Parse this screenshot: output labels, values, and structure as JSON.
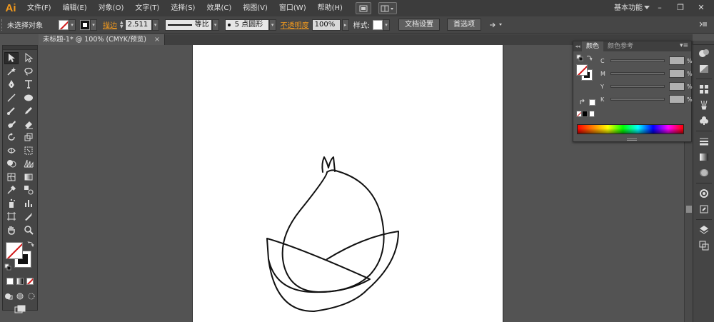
{
  "app": {
    "logo": "Ai"
  },
  "menu": [
    "文件(F)",
    "编辑(E)",
    "对象(O)",
    "文字(T)",
    "选择(S)",
    "效果(C)",
    "视图(V)",
    "窗口(W)",
    "帮助(H)"
  ],
  "workspace": {
    "label": "基本功能"
  },
  "window_controls": {
    "minimize": "–",
    "restore": "❐",
    "close": "✕"
  },
  "control_bar": {
    "selection_label": "未选择对象",
    "stroke_label": "描边",
    "stroke_weight": "2.511",
    "stroke_profile": "等比",
    "brush_label": "5 点圆形",
    "opacity_label": "不透明度",
    "opacity_value": "100%",
    "style_label": "样式:",
    "doc_setup_button": "文档设置",
    "preferences_button": "首选项"
  },
  "document_tab": {
    "title": "未标题-1* @ 100% (CMYK/预览)",
    "close": "×"
  },
  "color_panel": {
    "tabs": [
      "颜色",
      "颜色参考"
    ],
    "channels": [
      "C",
      "M",
      "Y",
      "K"
    ],
    "percent": "%"
  },
  "colors": {
    "accent": "#f39a1d",
    "none_slash": "#d01818"
  }
}
